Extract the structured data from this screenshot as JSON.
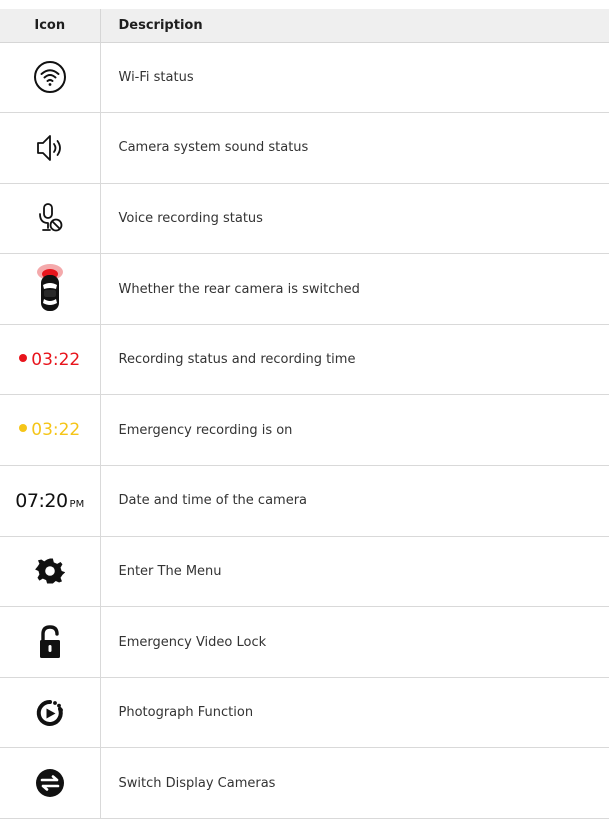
{
  "header": {
    "icon": "Icon",
    "description": "Description"
  },
  "colors": {
    "recording": "#e8141c",
    "emergency": "#f5c518"
  },
  "rows": [
    {
      "icon": "wifi-status-icon",
      "description": "Wi-Fi status"
    },
    {
      "icon": "speaker-icon",
      "description": "Camera system sound status"
    },
    {
      "icon": "microphone-muted-icon",
      "description": "Voice recording status"
    },
    {
      "icon": "car-rear-camera-icon",
      "description": "Whether the rear camera is switched"
    },
    {
      "icon": "recording-dot-icon",
      "time": "03:22",
      "description": "Recording status and recording time"
    },
    {
      "icon": "emergency-dot-icon",
      "time": "03:22",
      "description": "Emergency recording is on"
    },
    {
      "icon": "clock-text",
      "time": "07:20",
      "ampm": "PM",
      "description": "Date and time of the camera"
    },
    {
      "icon": "gear-icon",
      "description": "Enter The Menu"
    },
    {
      "icon": "unlock-icon",
      "description": "Emergency Video Lock"
    },
    {
      "icon": "photo-timer-icon",
      "description": "Photograph Function"
    },
    {
      "icon": "switch-cameras-icon",
      "description": "Switch Display Cameras"
    }
  ]
}
